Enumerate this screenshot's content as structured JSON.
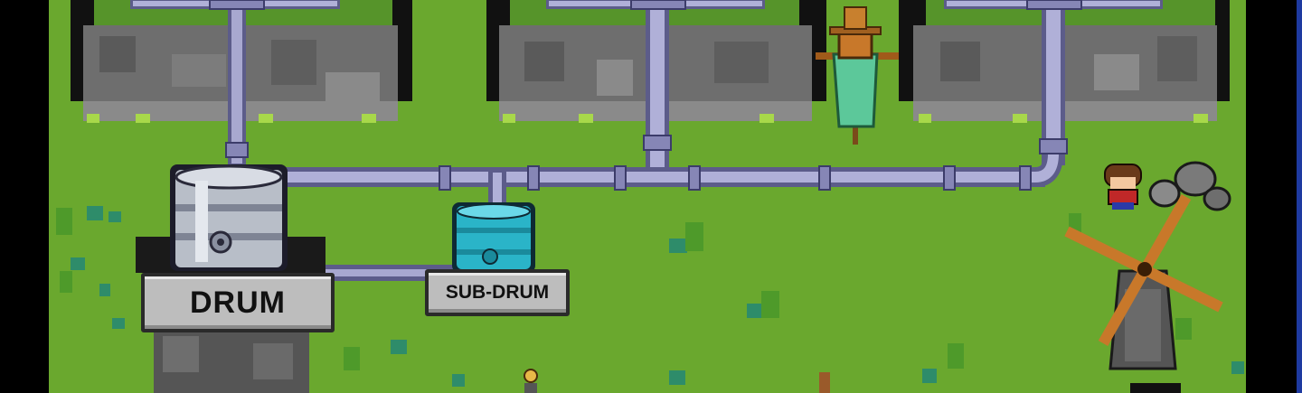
{
  "labels": {
    "main_tank": "DRUM",
    "secondary_tank": "SUB-DRUM"
  },
  "colors": {
    "grass": "#6aa82e",
    "grass_dark": "#4c8a22",
    "stone": "#6e6e6e",
    "pipe": "#9c9cc4",
    "pipe_dark": "#5c5c8a",
    "main_drum": "#b8bec8",
    "sub_drum": "#2ab4c8",
    "scarecrow_cloak": "#5cc89a",
    "windmill_wood": "#c8782a"
  },
  "sprites": [
    "stone-field",
    "pipe-network",
    "main-drum",
    "sub-drum",
    "scarecrow",
    "windmill",
    "villager",
    "rock-pile"
  ]
}
